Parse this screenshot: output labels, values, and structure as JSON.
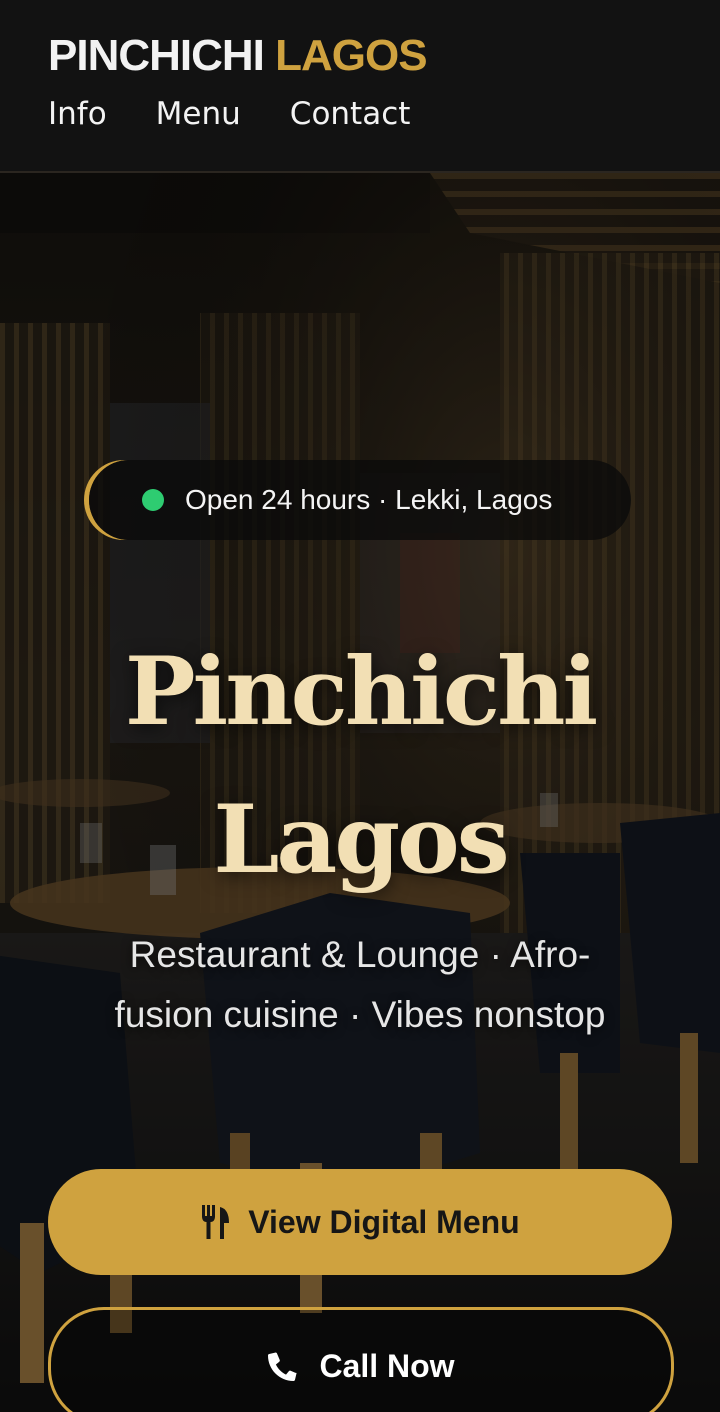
{
  "header": {
    "brand_part1": "PINCHICHI",
    "brand_part2": "LAGOS",
    "nav": [
      {
        "label": "Info"
      },
      {
        "label": "Menu"
      },
      {
        "label": "Contact"
      }
    ]
  },
  "hero": {
    "badge": {
      "text": "Open 24 hours · Lekki, Lagos",
      "status_color": "#2ecc71"
    },
    "title_line1": "Pinchichi",
    "title_line2": "Lagos",
    "subtitle": "Restaurant & Lounge · Afro-fusion cuisine · Vibes nonstop",
    "primary_button": {
      "label": "View Digital Menu",
      "icon": "utensils-icon"
    },
    "secondary_button": {
      "label": "Call Now",
      "icon": "phone-icon"
    }
  },
  "colors": {
    "accent_gold": "#cfa23f",
    "title_cream": "#f2dfb4",
    "header_bg": "#121212"
  }
}
